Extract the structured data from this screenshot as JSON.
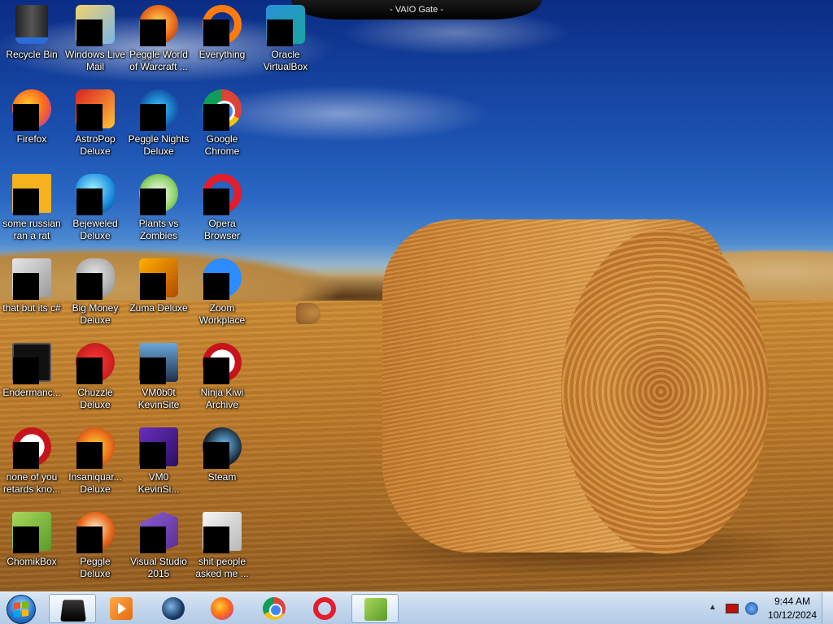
{
  "gadget": {
    "title": "- VAIO Gate -"
  },
  "desktop_icons": [
    {
      "label": "Recycle Bin",
      "icon": "recycle-bin-icon"
    },
    {
      "label": "Windows Live\nMail",
      "icon": "mail-icon"
    },
    {
      "label": "Peggle World\nof Warcraft ...",
      "icon": "peggle-wow-icon"
    },
    {
      "label": "Everything",
      "icon": "everything-search-icon"
    },
    {
      "label": "Oracle\nVirtualBox",
      "icon": "virtualbox-icon"
    },
    {
      "label": "Firefox",
      "icon": "firefox-icon"
    },
    {
      "label": "AstroPop\nDeluxe",
      "icon": "astropop-icon"
    },
    {
      "label": "Peggle Nights\nDeluxe",
      "icon": "peggle-nights-icon"
    },
    {
      "label": "Google\nChrome",
      "icon": "chrome-icon"
    },
    {
      "label": "some russian\nran a rat",
      "icon": "adobe-effects-icon"
    },
    {
      "label": "Bejeweled\nDeluxe",
      "icon": "bejeweled-icon"
    },
    {
      "label": "Plants vs\nZombies",
      "icon": "plants-vs-zombies-icon"
    },
    {
      "label": "Opera\nBrowser",
      "icon": "opera-icon"
    },
    {
      "label": "that but its c#",
      "icon": "windows-stack-icon"
    },
    {
      "label": "Big Money\nDeluxe",
      "icon": "big-money-icon"
    },
    {
      "label": "Zuma Deluxe",
      "icon": "zuma-icon"
    },
    {
      "label": "Zoom\nWorkplace",
      "icon": "zoom-icon"
    },
    {
      "label": "Endermanc...",
      "icon": "terminal-icon"
    },
    {
      "label": "Chuzzle\nDeluxe",
      "icon": "chuzzle-icon"
    },
    {
      "label": "VM0b0t\nKevinSite",
      "icon": "monitor-icon"
    },
    {
      "label": "Ninja Kiwi\nArchive",
      "icon": "ninja-kiwi-icon"
    },
    {
      "label": "none of you\nretards kno...",
      "icon": "red-circle-icon"
    },
    {
      "label": "Insaniquar...\nDeluxe",
      "icon": "insaniquarium-icon"
    },
    {
      "label": "VM0\nKevinSi...",
      "icon": "purple-app-icon"
    },
    {
      "label": "Steam",
      "icon": "steam-icon"
    },
    {
      "label": "ChomikBox",
      "icon": "chomikbox-icon"
    },
    {
      "label": "Peggle Deluxe",
      "icon": "peggle-deluxe-icon"
    },
    {
      "label": "Visual Studio\n2015",
      "icon": "visual-studio-icon"
    },
    {
      "label": "shit people\nasked me ...",
      "icon": "folder-icon"
    }
  ],
  "taskbar": {
    "start_label": "Start",
    "pinned": [
      {
        "name": "VAIO Gate",
        "icon": "vaio-icon",
        "active": true
      },
      {
        "name": "Windows Media Player",
        "icon": "media-player-icon",
        "active": false
      },
      {
        "name": "Globe",
        "icon": "globe-icon",
        "active": false
      },
      {
        "name": "Firefox",
        "icon": "firefox-icon",
        "active": false
      },
      {
        "name": "Google Chrome",
        "icon": "chrome-icon",
        "active": false
      },
      {
        "name": "Opera",
        "icon": "opera-icon",
        "active": false
      },
      {
        "name": "ChomikBox",
        "icon": "chomikbox-icon",
        "active": true
      }
    ]
  },
  "tray": {
    "time": "9:44 AM",
    "date": "10/12/2024"
  }
}
